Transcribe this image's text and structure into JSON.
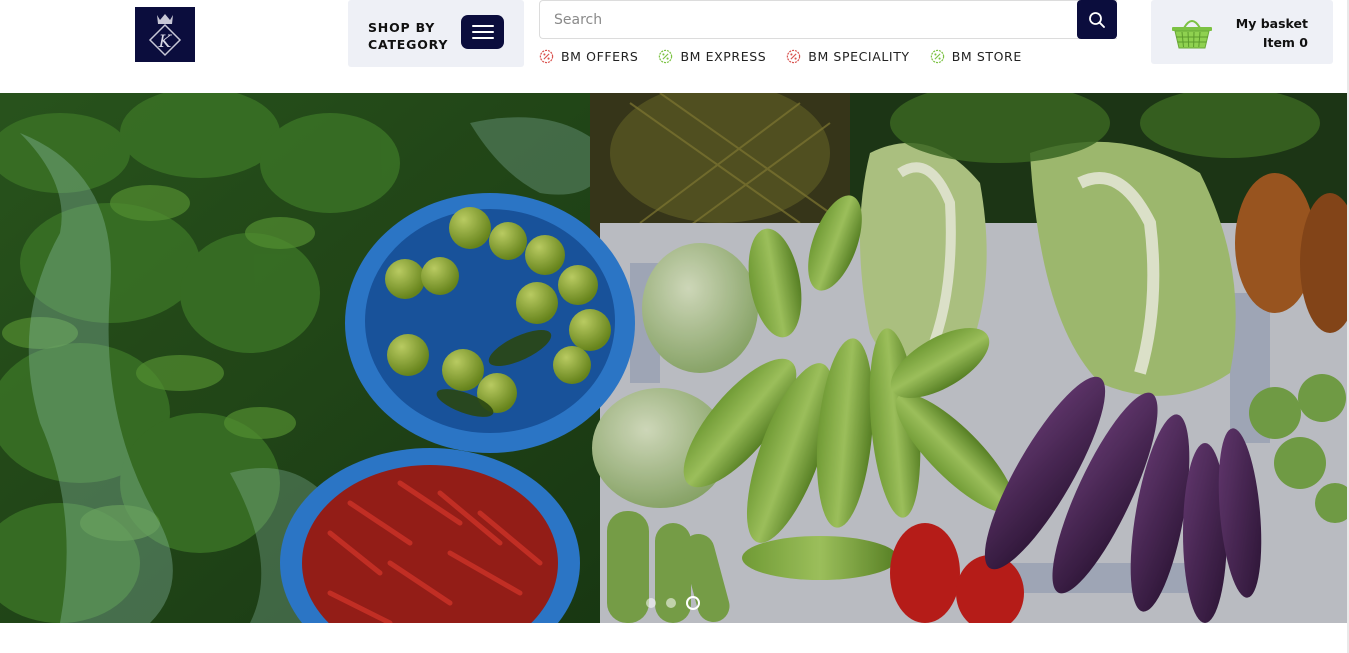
{
  "header": {
    "logo": {
      "letter": "K",
      "icon": "crown-diamond-logo-icon"
    },
    "shop_by_category": {
      "label": "SHOP BY CATEGORY",
      "menu_icon": "hamburger-menu-icon"
    },
    "search": {
      "placeholder": "Search",
      "value": "",
      "button_icon": "search-icon"
    },
    "quick_links": [
      {
        "label": "BM OFFERS",
        "icon": "percent-badge-icon",
        "color": "#d9534f"
      },
      {
        "label": "BM EXPRESS",
        "icon": "percent-badge-icon",
        "color": "#7cc243"
      },
      {
        "label": "BM SPECIALITY",
        "icon": "percent-badge-icon",
        "color": "#d9534f"
      },
      {
        "label": "BM STORE",
        "icon": "percent-badge-icon",
        "color": "#7cc243"
      }
    ],
    "basket": {
      "title": "My basket",
      "count_label": "Item 0",
      "icon": "basket-icon",
      "icon_color": "#7cc243"
    }
  },
  "hero": {
    "image": "vegetable-market-photo",
    "slides_total": 3,
    "active_slide": 3
  },
  "colors": {
    "brand_navy": "#0b0d3d",
    "panel_bg": "#eef0f6",
    "accent_green": "#7cc243",
    "accent_red": "#d9534f"
  }
}
